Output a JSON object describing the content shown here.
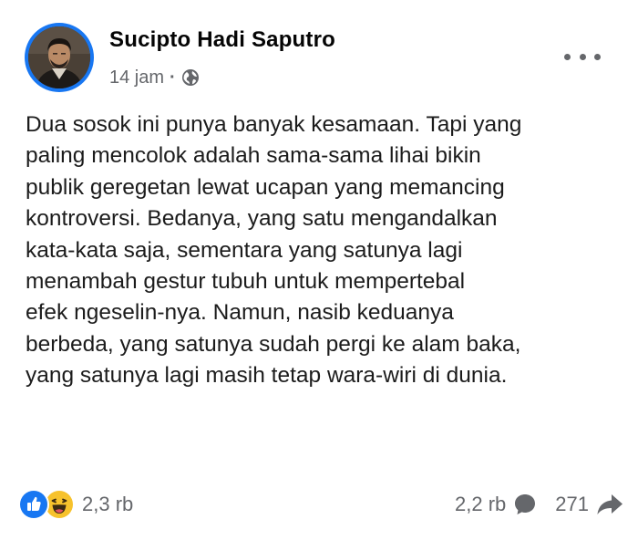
{
  "post": {
    "author": "Sucipto Hadi Saputro",
    "timestamp": "14 jam",
    "separator": "·",
    "audience_icon": "globe-icon",
    "more_icon": "more-horizontal-icon",
    "text_lines": [
      "Dua sosok ini punya banyak kesamaan. Tapi yang",
      "paling mencolok adalah sama-sama lihai bikin",
      "publik geregetan lewat ucapan yang memancing",
      "kontroversi. Bedanya, yang satu mengandalkan",
      "kata-kata saja, sementara yang satunya lagi",
      "menambah gestur tubuh untuk mempertebal",
      "efek ngeselin-nya. Namun, nasib keduanya",
      "berbeda, yang satunya sudah pergi ke alam baka,",
      "yang satunya lagi masih tetap wara-wiri di dunia."
    ]
  },
  "footer": {
    "reactions": {
      "icons": [
        "like-icon",
        "haha-icon"
      ],
      "count": "2,3 rb"
    },
    "comments": {
      "count": "2,2 rb",
      "icon": "comment-icon"
    },
    "shares": {
      "count": "271",
      "icon": "share-icon"
    }
  },
  "colors": {
    "brand_blue": "#1877f2",
    "text": "#050505",
    "secondary_text": "#65676b",
    "haha_yellow": "#f7c22c"
  }
}
